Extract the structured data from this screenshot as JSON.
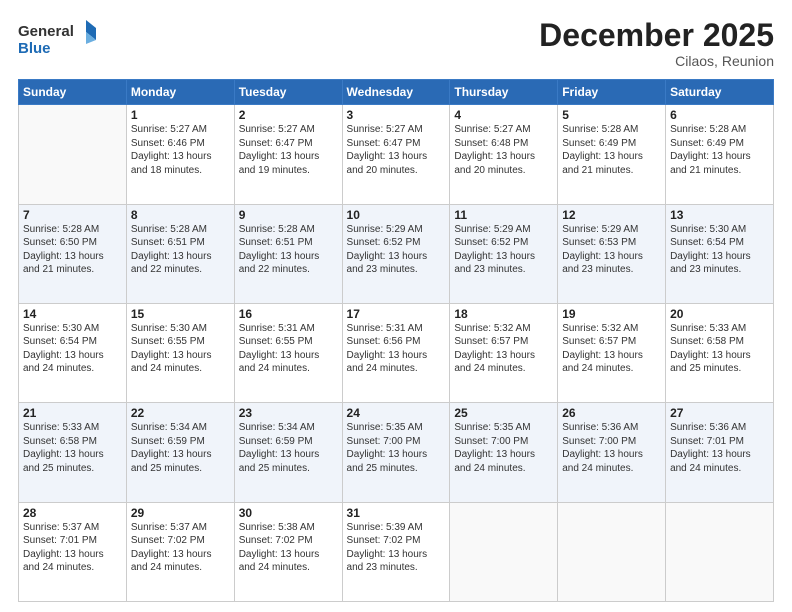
{
  "header": {
    "logo_line1": "General",
    "logo_line2": "Blue",
    "month": "December 2025",
    "location": "Cilaos, Reunion"
  },
  "weekdays": [
    "Sunday",
    "Monday",
    "Tuesday",
    "Wednesday",
    "Thursday",
    "Friday",
    "Saturday"
  ],
  "weeks": [
    [
      {
        "day": "",
        "sunrise": "",
        "sunset": "",
        "daylight": ""
      },
      {
        "day": "1",
        "sunrise": "Sunrise: 5:27 AM",
        "sunset": "Sunset: 6:46 PM",
        "daylight": "Daylight: 13 hours and 18 minutes."
      },
      {
        "day": "2",
        "sunrise": "Sunrise: 5:27 AM",
        "sunset": "Sunset: 6:47 PM",
        "daylight": "Daylight: 13 hours and 19 minutes."
      },
      {
        "day": "3",
        "sunrise": "Sunrise: 5:27 AM",
        "sunset": "Sunset: 6:47 PM",
        "daylight": "Daylight: 13 hours and 20 minutes."
      },
      {
        "day": "4",
        "sunrise": "Sunrise: 5:27 AM",
        "sunset": "Sunset: 6:48 PM",
        "daylight": "Daylight: 13 hours and 20 minutes."
      },
      {
        "day": "5",
        "sunrise": "Sunrise: 5:28 AM",
        "sunset": "Sunset: 6:49 PM",
        "daylight": "Daylight: 13 hours and 21 minutes."
      },
      {
        "day": "6",
        "sunrise": "Sunrise: 5:28 AM",
        "sunset": "Sunset: 6:49 PM",
        "daylight": "Daylight: 13 hours and 21 minutes."
      }
    ],
    [
      {
        "day": "7",
        "sunrise": "Sunrise: 5:28 AM",
        "sunset": "Sunset: 6:50 PM",
        "daylight": "Daylight: 13 hours and 21 minutes."
      },
      {
        "day": "8",
        "sunrise": "Sunrise: 5:28 AM",
        "sunset": "Sunset: 6:51 PM",
        "daylight": "Daylight: 13 hours and 22 minutes."
      },
      {
        "day": "9",
        "sunrise": "Sunrise: 5:28 AM",
        "sunset": "Sunset: 6:51 PM",
        "daylight": "Daylight: 13 hours and 22 minutes."
      },
      {
        "day": "10",
        "sunrise": "Sunrise: 5:29 AM",
        "sunset": "Sunset: 6:52 PM",
        "daylight": "Daylight: 13 hours and 23 minutes."
      },
      {
        "day": "11",
        "sunrise": "Sunrise: 5:29 AM",
        "sunset": "Sunset: 6:52 PM",
        "daylight": "Daylight: 13 hours and 23 minutes."
      },
      {
        "day": "12",
        "sunrise": "Sunrise: 5:29 AM",
        "sunset": "Sunset: 6:53 PM",
        "daylight": "Daylight: 13 hours and 23 minutes."
      },
      {
        "day": "13",
        "sunrise": "Sunrise: 5:30 AM",
        "sunset": "Sunset: 6:54 PM",
        "daylight": "Daylight: 13 hours and 23 minutes."
      }
    ],
    [
      {
        "day": "14",
        "sunrise": "Sunrise: 5:30 AM",
        "sunset": "Sunset: 6:54 PM",
        "daylight": "Daylight: 13 hours and 24 minutes."
      },
      {
        "day": "15",
        "sunrise": "Sunrise: 5:30 AM",
        "sunset": "Sunset: 6:55 PM",
        "daylight": "Daylight: 13 hours and 24 minutes."
      },
      {
        "day": "16",
        "sunrise": "Sunrise: 5:31 AM",
        "sunset": "Sunset: 6:55 PM",
        "daylight": "Daylight: 13 hours and 24 minutes."
      },
      {
        "day": "17",
        "sunrise": "Sunrise: 5:31 AM",
        "sunset": "Sunset: 6:56 PM",
        "daylight": "Daylight: 13 hours and 24 minutes."
      },
      {
        "day": "18",
        "sunrise": "Sunrise: 5:32 AM",
        "sunset": "Sunset: 6:57 PM",
        "daylight": "Daylight: 13 hours and 24 minutes."
      },
      {
        "day": "19",
        "sunrise": "Sunrise: 5:32 AM",
        "sunset": "Sunset: 6:57 PM",
        "daylight": "Daylight: 13 hours and 24 minutes."
      },
      {
        "day": "20",
        "sunrise": "Sunrise: 5:33 AM",
        "sunset": "Sunset: 6:58 PM",
        "daylight": "Daylight: 13 hours and 25 minutes."
      }
    ],
    [
      {
        "day": "21",
        "sunrise": "Sunrise: 5:33 AM",
        "sunset": "Sunset: 6:58 PM",
        "daylight": "Daylight: 13 hours and 25 minutes."
      },
      {
        "day": "22",
        "sunrise": "Sunrise: 5:34 AM",
        "sunset": "Sunset: 6:59 PM",
        "daylight": "Daylight: 13 hours and 25 minutes."
      },
      {
        "day": "23",
        "sunrise": "Sunrise: 5:34 AM",
        "sunset": "Sunset: 6:59 PM",
        "daylight": "Daylight: 13 hours and 25 minutes."
      },
      {
        "day": "24",
        "sunrise": "Sunrise: 5:35 AM",
        "sunset": "Sunset: 7:00 PM",
        "daylight": "Daylight: 13 hours and 25 minutes."
      },
      {
        "day": "25",
        "sunrise": "Sunrise: 5:35 AM",
        "sunset": "Sunset: 7:00 PM",
        "daylight": "Daylight: 13 hours and 24 minutes."
      },
      {
        "day": "26",
        "sunrise": "Sunrise: 5:36 AM",
        "sunset": "Sunset: 7:00 PM",
        "daylight": "Daylight: 13 hours and 24 minutes."
      },
      {
        "day": "27",
        "sunrise": "Sunrise: 5:36 AM",
        "sunset": "Sunset: 7:01 PM",
        "daylight": "Daylight: 13 hours and 24 minutes."
      }
    ],
    [
      {
        "day": "28",
        "sunrise": "Sunrise: 5:37 AM",
        "sunset": "Sunset: 7:01 PM",
        "daylight": "Daylight: 13 hours and 24 minutes."
      },
      {
        "day": "29",
        "sunrise": "Sunrise: 5:37 AM",
        "sunset": "Sunset: 7:02 PM",
        "daylight": "Daylight: 13 hours and 24 minutes."
      },
      {
        "day": "30",
        "sunrise": "Sunrise: 5:38 AM",
        "sunset": "Sunset: 7:02 PM",
        "daylight": "Daylight: 13 hours and 24 minutes."
      },
      {
        "day": "31",
        "sunrise": "Sunrise: 5:39 AM",
        "sunset": "Sunset: 7:02 PM",
        "daylight": "Daylight: 13 hours and 23 minutes."
      },
      {
        "day": "",
        "sunrise": "",
        "sunset": "",
        "daylight": ""
      },
      {
        "day": "",
        "sunrise": "",
        "sunset": "",
        "daylight": ""
      },
      {
        "day": "",
        "sunrise": "",
        "sunset": "",
        "daylight": ""
      }
    ]
  ]
}
